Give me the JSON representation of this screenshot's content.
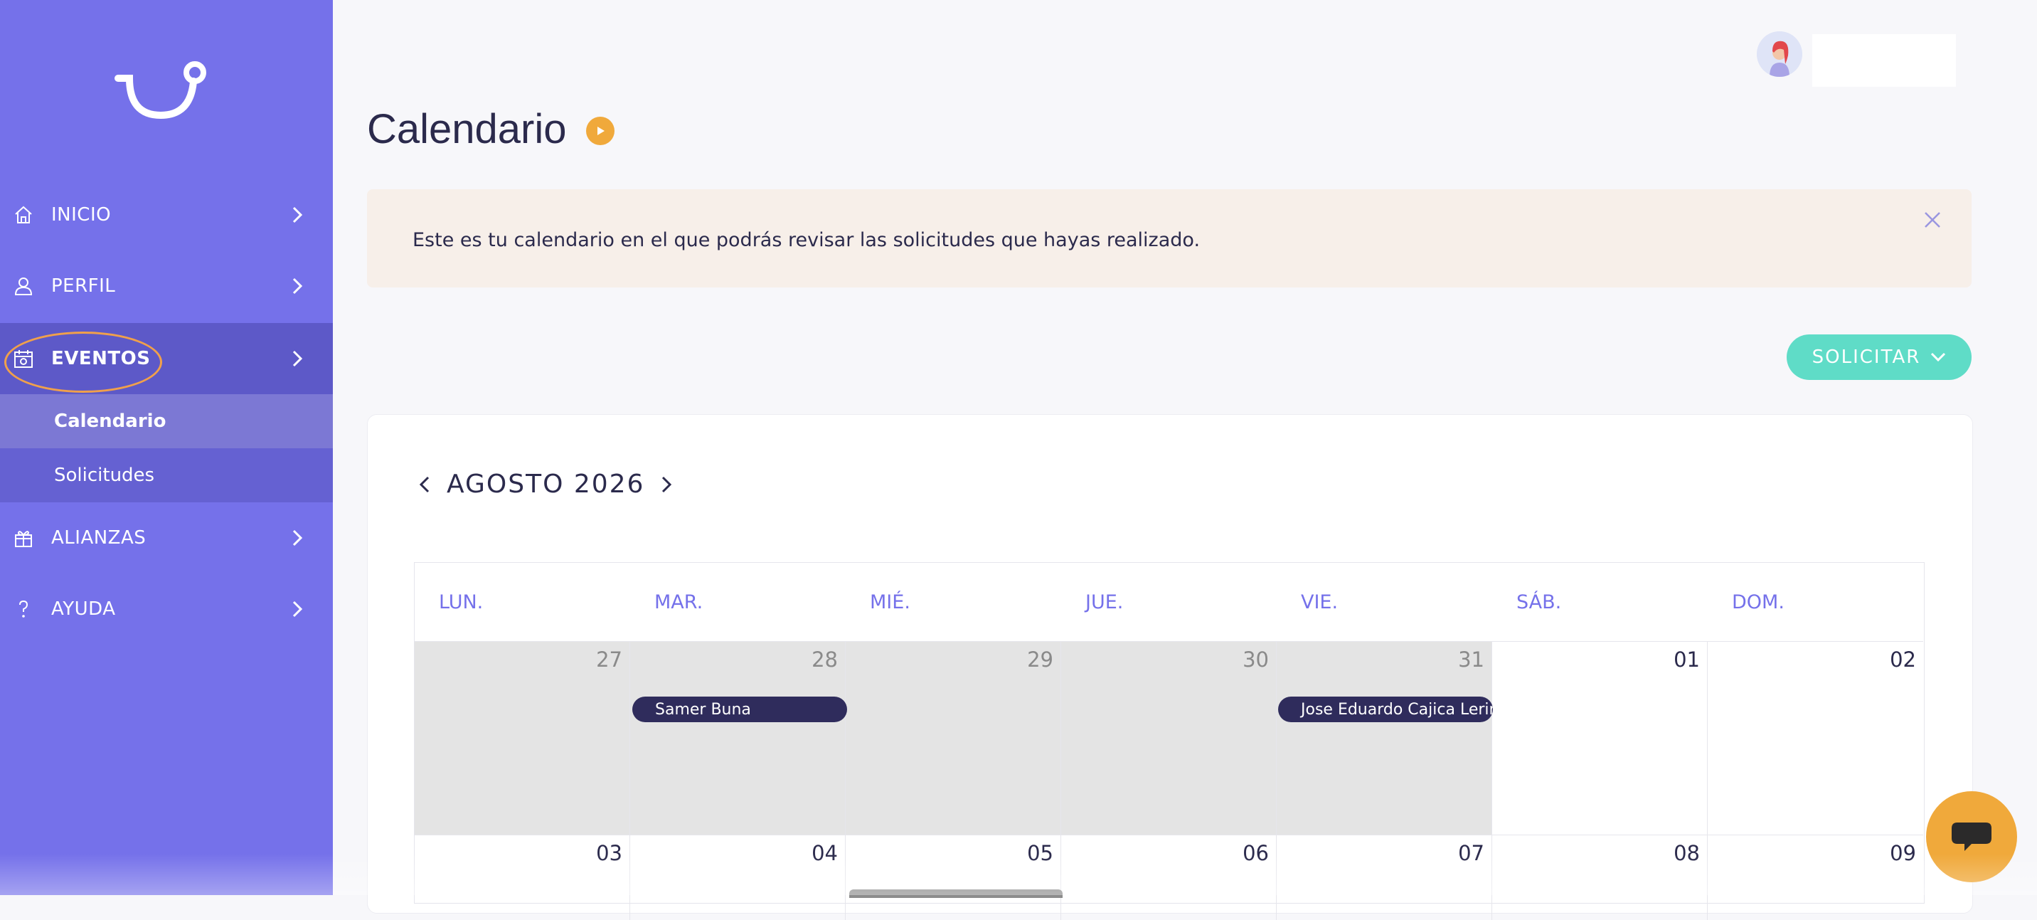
{
  "sidebar": {
    "items": [
      {
        "label": "INICIO",
        "icon": "home-icon"
      },
      {
        "label": "PERFIL",
        "icon": "user-icon"
      },
      {
        "label": "EVENTOS",
        "icon": "calendar-icon"
      },
      {
        "label": "ALIANZAS",
        "icon": "gift-icon"
      },
      {
        "label": "AYUDA",
        "icon": "help-icon"
      }
    ],
    "sub_items": [
      {
        "label": "Calendario"
      },
      {
        "label": "Solicitudes"
      }
    ]
  },
  "header": {
    "title": "Calendario"
  },
  "notice": {
    "text": "Este es tu calendario en el que podrás revisar las solicitudes que hayas realizado."
  },
  "actions": {
    "solicitar": "SOLICITAR"
  },
  "calendar": {
    "month": "AGOSTO 2026",
    "weekdays": [
      "LUN.",
      "MAR.",
      "MIÉ.",
      "JUE.",
      "VIE.",
      "SÁB.",
      "DOM."
    ],
    "week1": [
      "27",
      "28",
      "29",
      "30",
      "31",
      "01",
      "02"
    ],
    "week2": [
      "03",
      "04",
      "05",
      "06",
      "07",
      "08",
      "09"
    ],
    "events": [
      {
        "name": "Samer Buna",
        "day": "28"
      },
      {
        "name": "Jose Eduardo Cajica Lerin",
        "day": "31"
      }
    ]
  },
  "colors": {
    "sidebar": "#7571ea",
    "accent_orange": "#f0a93b",
    "solicitar": "#5fdcc7",
    "event_bg": "#2f2c5c"
  }
}
